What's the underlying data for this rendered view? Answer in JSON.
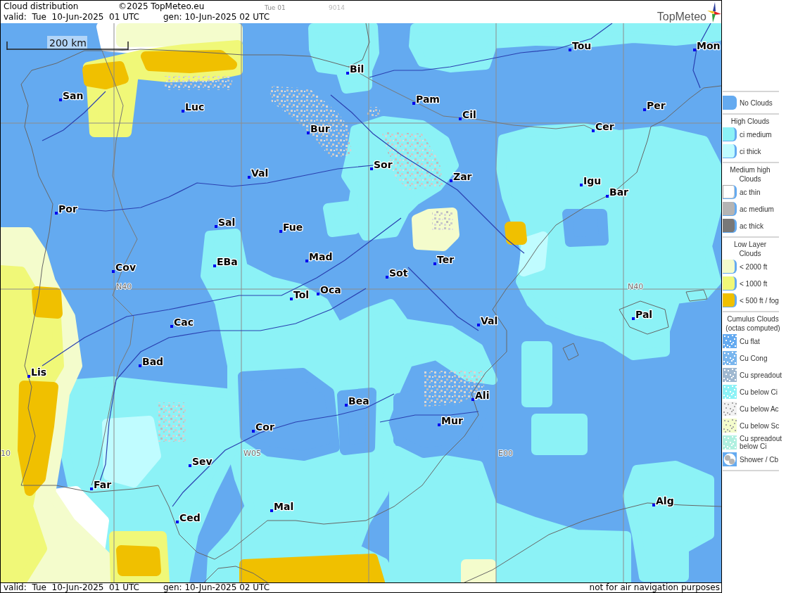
{
  "header": {
    "title": "Cloud distribution",
    "copyright": "©2025 TopMeteo.eu",
    "run_label": "Tue 01",
    "code": "9014",
    "valid": "valid:  Tue  10-Jun-2025  01 UTC",
    "generated": "gen: 10-Jun-2025 02 UTC",
    "logo_text": "TopMeteo"
  },
  "map": {
    "scale_label": "200 km",
    "grid_labels": [
      "N40",
      "N40",
      "10",
      "W05",
      "E00"
    ],
    "cities": [
      "Tou",
      "Mon",
      "Bil",
      "San",
      "Pam",
      "Luc",
      "Per",
      "Cil",
      "Bur",
      "Cer",
      "Sor",
      "Val",
      "Zar",
      "Igu",
      "Bar",
      "Por",
      "Sal",
      "Fue",
      "Mad",
      "EBa",
      "Ter",
      "Cov",
      "Sot",
      "Oca",
      "Tol",
      "Pal",
      "Cac",
      "Val",
      "Bad",
      "Lis",
      "Ali",
      "Bea",
      "Mur",
      "Cor",
      "Sev",
      "Far",
      "Alg",
      "Mal",
      "Ced"
    ]
  },
  "legend": {
    "sections": [
      {
        "items": [
          {
            "label": "No Clouds",
            "kind": "solid",
            "color": "#64aaf0"
          }
        ]
      },
      {
        "title": "High Clouds",
        "items": [
          {
            "label": "ci medium",
            "kind": "solid",
            "color": "#8cf2f6"
          },
          {
            "label": "ci thick",
            "kind": "solid",
            "color": "#c0fcff"
          }
        ]
      },
      {
        "title": "Medium high Clouds",
        "items": [
          {
            "label": "ac thin",
            "kind": "solid",
            "color": "#ffffff"
          },
          {
            "label": "ac medium",
            "kind": "solid",
            "color": "#b4b4b4"
          },
          {
            "label": "ac thick",
            "kind": "solid",
            "color": "#787878"
          }
        ]
      },
      {
        "title": "Low Layer Clouds",
        "items": [
          {
            "label": "< 2000 ft",
            "kind": "solid",
            "color": "#f4fccc"
          },
          {
            "label": "< 1000 ft",
            "kind": "solid",
            "color": "#f0f878"
          },
          {
            "label": "< 500 ft / fog",
            "kind": "solid",
            "color": "#f0c000"
          }
        ]
      },
      {
        "title": "Cumulus Clouds",
        "subtitle": "(octas computed)",
        "items": [
          {
            "label": "Cu flat",
            "kind": "speckled",
            "color": "#64aaf0"
          },
          {
            "label": "Cu Cong",
            "kind": "speckled",
            "color": "#7ab6ee"
          },
          {
            "label": "Cu spreadout",
            "kind": "speckled",
            "color": "#9fb8d0"
          },
          {
            "label": "Cu below Ci",
            "kind": "speckled",
            "color": "#8cf2f6"
          },
          {
            "label": "Cu below Ac",
            "kind": "speckled",
            "color": "#f2f2f2"
          },
          {
            "label": "Cu below Sc",
            "kind": "speckled",
            "color": "#f4fccc"
          },
          {
            "label": "Cu spreadout below Ci",
            "kind": "speckled",
            "color": "#b0f0e0"
          },
          {
            "label": "Shower / Cb",
            "kind": "shower",
            "color": "#64aaf0"
          }
        ]
      }
    ]
  },
  "footer": {
    "valid": "valid:  Tue  10-Jun-2025  01 UTC",
    "generated": "gen: 10-Jun-2025 02 UTC",
    "disclaimer": "not for air navigation purposes"
  }
}
